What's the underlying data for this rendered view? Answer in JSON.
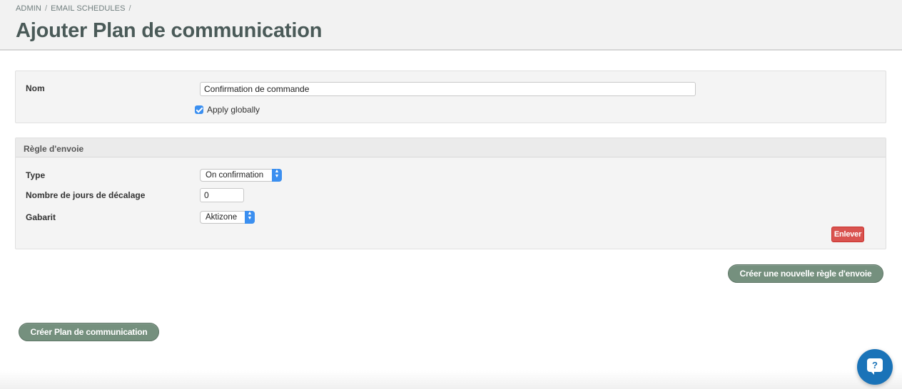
{
  "breadcrumb": {
    "items": [
      "ADMIN",
      "EMAIL SCHEDULES"
    ],
    "separator": "/"
  },
  "page": {
    "title": "Ajouter Plan de communication"
  },
  "nom_section": {
    "label": "Nom",
    "value": "Confirmation de commande",
    "apply_globally": {
      "label": "Apply globally",
      "checked": true
    }
  },
  "rule_section": {
    "heading": "Règle d'envoie",
    "type": {
      "label": "Type",
      "selected": "On confirmation"
    },
    "offset": {
      "label": "Nombre de jours de décalage",
      "value": "0"
    },
    "template": {
      "label": "Gabarit",
      "selected": "Aktizone"
    },
    "remove_label": "Enlever"
  },
  "buttons": {
    "new_rule": "Créer une nouvelle règle d'envoie",
    "create_plan": "Créer Plan de communication"
  },
  "help": {
    "glyph": "?"
  },
  "colors": {
    "accent_blue": "#3b8ff0",
    "green_button": "#75907e",
    "danger": "#d9534f",
    "title": "#4a5a58",
    "help_button": "#1a73b8"
  }
}
